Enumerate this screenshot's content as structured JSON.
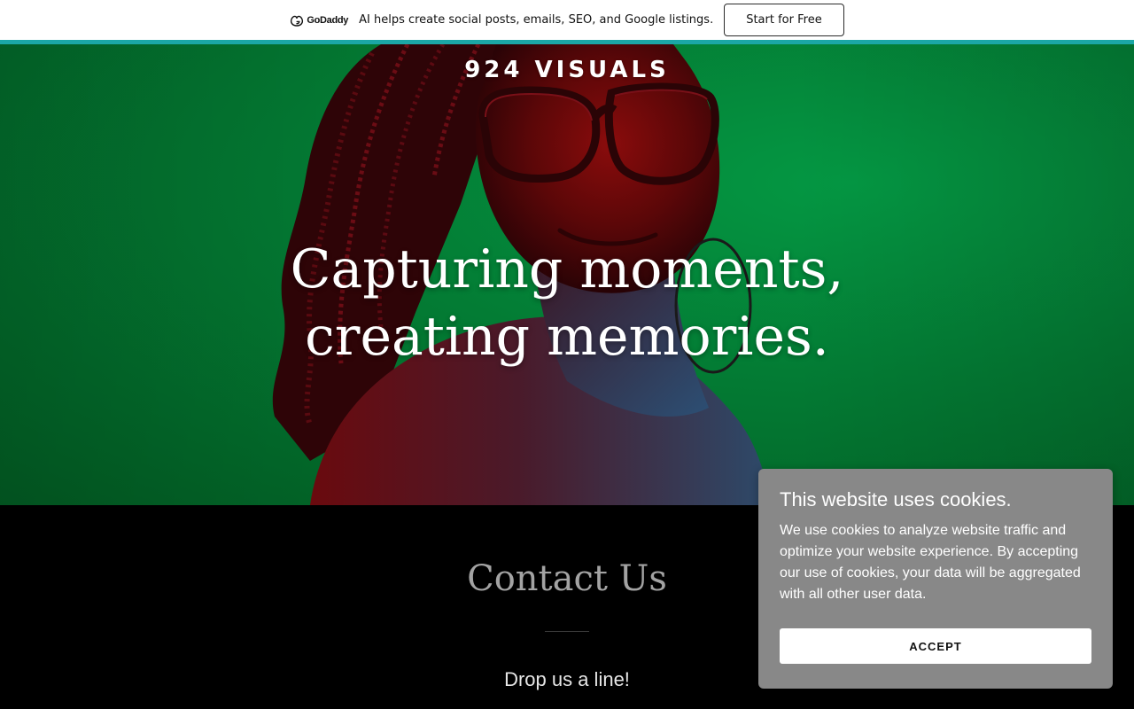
{
  "promo": {
    "brand": "GoDaddy",
    "message": "AI helps create social posts, emails, SEO, and Google listings.",
    "cta": "Start for Free",
    "accent_color": "#1ba7a6"
  },
  "hero": {
    "site_title": "924 VISUALS",
    "tagline_line1": "Capturing moments,",
    "tagline_line2": "creating memories.",
    "background_color": "#049843",
    "image": "portrait-photo"
  },
  "contact": {
    "heading": "Contact Us",
    "subheading": "Drop us a line!"
  },
  "cookie_banner": {
    "title": "This website uses cookies.",
    "body": "We use cookies to analyze website traffic and optimize your website experience. By accepting our use of cookies, your data will be aggregated with all other user data.",
    "accept_label": "ACCEPT",
    "background_color": "#888888"
  }
}
